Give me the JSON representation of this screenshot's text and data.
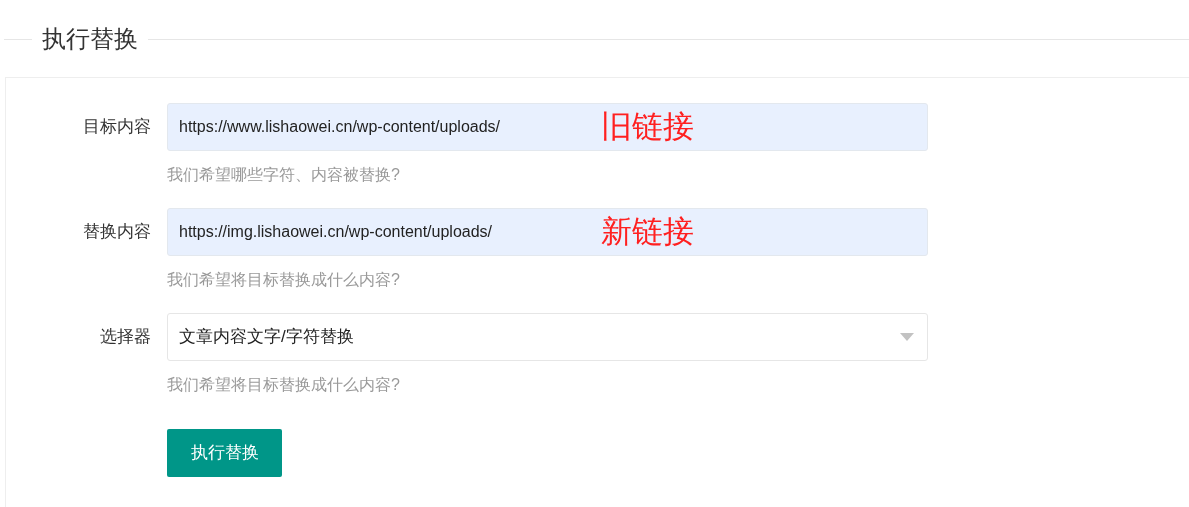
{
  "section": {
    "title": "执行替换"
  },
  "fields": [
    {
      "kind": "text",
      "label": "目标内容",
      "value": "https://www.lishaowei.cn/wp-content/uploads/",
      "hint": "我们希望哪些字符、内容被替换?",
      "annotation": "旧链接"
    },
    {
      "kind": "text",
      "label": "替换内容",
      "value": "https://img.lishaowei.cn/wp-content/uploads/",
      "hint": "我们希望将目标替换成什么内容?",
      "annotation": "新链接"
    },
    {
      "kind": "select",
      "label": "选择器",
      "value": "文章内容文字/字符替换",
      "hint": "我们希望将目标替换成什么内容?"
    }
  ],
  "submit": {
    "label": "执行替换"
  }
}
